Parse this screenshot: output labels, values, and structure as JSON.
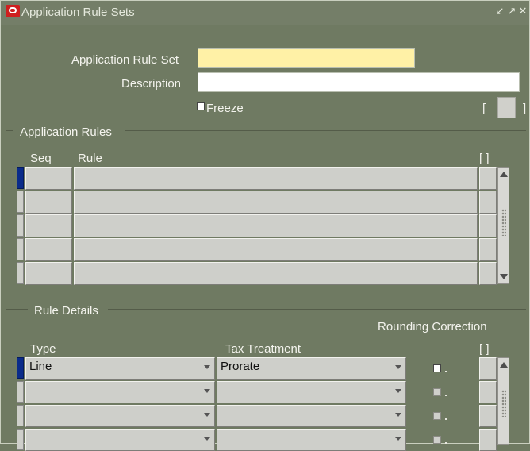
{
  "window": {
    "title": "Application Rule Sets"
  },
  "header": {
    "rule_set_label": "Application Rule Set",
    "rule_set_value": "",
    "description_label": "Description",
    "description_value": "",
    "freeze_label": "Freeze",
    "freeze_checked": false,
    "bracket_open": "[",
    "bracket_close": "]"
  },
  "application_rules": {
    "section_label": "Application Rules",
    "columns": {
      "seq": "Seq",
      "rule": "Rule",
      "flex": "[ ]"
    },
    "rows": [
      {
        "seq": "",
        "rule": ""
      },
      {
        "seq": "",
        "rule": ""
      },
      {
        "seq": "",
        "rule": ""
      },
      {
        "seq": "",
        "rule": ""
      },
      {
        "seq": "",
        "rule": ""
      }
    ]
  },
  "rule_details": {
    "section_label": "Rule Details",
    "rounding_label": "Rounding Correction",
    "columns": {
      "type": "Type",
      "tax_treatment": "Tax Treatment",
      "flex": "[ ]"
    },
    "rows": [
      {
        "type": "Line",
        "tax_treatment": "Prorate",
        "rounding": false
      },
      {
        "type": "",
        "tax_treatment": "",
        "rounding": false
      },
      {
        "type": "",
        "tax_treatment": "",
        "rounding": false
      },
      {
        "type": "",
        "tax_treatment": "",
        "rounding": false
      }
    ]
  },
  "colors": {
    "background": "#6f7a62",
    "required_field": "#fff1a6",
    "active_row": "#0a2b8a"
  }
}
